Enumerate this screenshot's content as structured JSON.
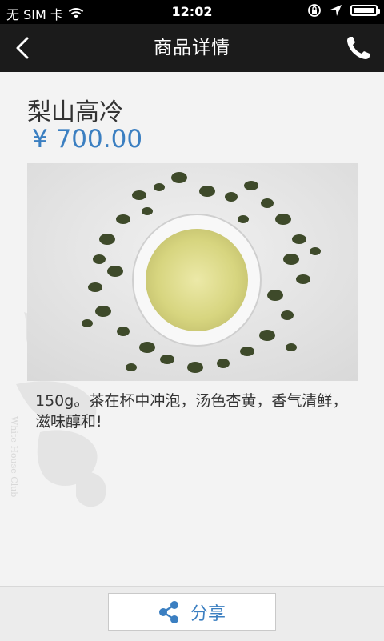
{
  "status_bar": {
    "carrier": "无 SIM 卡",
    "time": "12:02"
  },
  "nav": {
    "title": "商品详情"
  },
  "product": {
    "name": "梨山高冷",
    "price": "¥ 700.00",
    "description": "150g。茶在杯中冲泡，汤色杏黄，香气清鲜，滋味醇和!"
  },
  "watermark": {
    "text": "White House Club"
  },
  "bottom_bar": {
    "share_label": "分享"
  },
  "colors": {
    "accent": "#3b7fc1",
    "nav_background": "#1b1b1b",
    "page_background": "#f3f3f3"
  },
  "icons": [
    "wifi-icon",
    "rotation-lock-icon",
    "location-arrow-icon",
    "battery-icon",
    "back-arrow-icon",
    "phone-icon",
    "share-icon"
  ]
}
